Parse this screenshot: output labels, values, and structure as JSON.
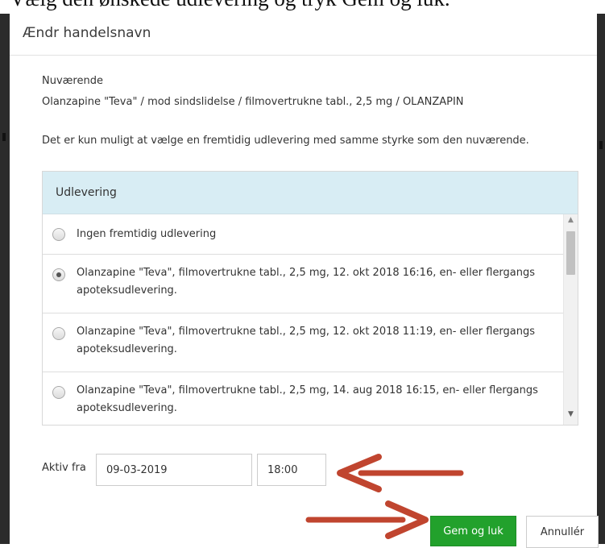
{
  "instruction": "Vælg den ønskede udlevering og tryk Gem og luk.",
  "dialog": {
    "title": "Ændr handelsnavn",
    "current_label": "Nuværende",
    "current_value": "Olanzapine \"Teva\" / mod sindslidelse / filmovertrukne tabl., 2,5 mg / OLANZAPIN",
    "info": "Det er kun muligt at vælge en fremtidig udlevering med samme styrke som den nuværende."
  },
  "table": {
    "header": "Udlevering",
    "rows": [
      {
        "label": "Ingen fremtidig udlevering",
        "selected": false
      },
      {
        "label": "Olanzapine \"Teva\", filmovertrukne tabl., 2,5 mg, 12. okt 2018 16:16, en- eller flergangs apoteksudlevering.",
        "selected": true
      },
      {
        "label": "Olanzapine \"Teva\", filmovertrukne tabl., 2,5 mg, 12. okt 2018 11:19, en- eller flergangs apoteksudlevering.",
        "selected": false
      },
      {
        "label": "Olanzapine \"Teva\", filmovertrukne tabl., 2,5 mg, 14. aug 2018 16:15, en- eller flergangs apoteksudlevering.",
        "selected": false
      }
    ]
  },
  "active_from": {
    "label": "Aktiv fra",
    "date": "09-03-2019",
    "time": "18:00"
  },
  "buttons": {
    "save": "Gem og luk",
    "cancel": "Annullér"
  },
  "icons": {
    "scroll_up": "scroll-up-arrow-icon",
    "scroll_down": "scroll-down-arrow-icon",
    "annotation_arrows": "red-arrow-icon"
  },
  "colors": {
    "header_bg": "#d8edf4",
    "save_button": "#22a12c",
    "annotation_arrow": "#c0452f"
  }
}
